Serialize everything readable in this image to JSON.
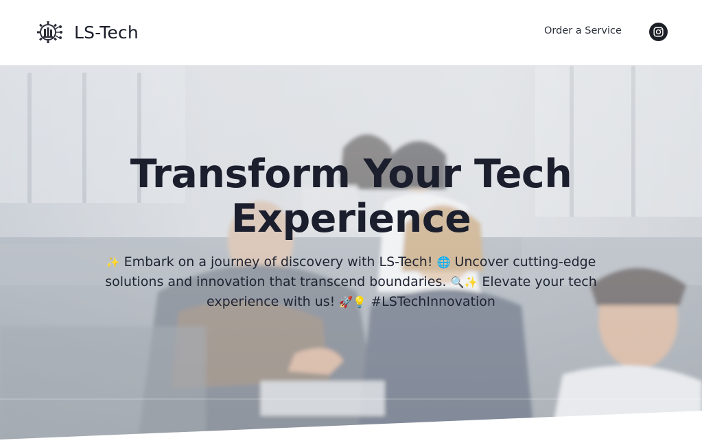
{
  "header": {
    "brand_name": "LS-Tech",
    "logo_icon": "gear-circuit-logo-icon",
    "nav_order_label": "Order a Service",
    "social_icon": "instagram-icon"
  },
  "hero": {
    "title_line1": "Transform Your Tech",
    "title_line2": "Experience",
    "text": {
      "line1_emoji_a": "✨",
      "line1_a": " Embark on a journey of discovery with LS-Tech! ",
      "line1_emoji_b": "🌐",
      "line1_b": " Uncover cutting-edge",
      "line2_a": "solutions and innovation that transcend boundaries. ",
      "line2_emoji": "🔍✨",
      "line2_b": " Elevate your tech",
      "line3_a": "experience with us! ",
      "line3_emoji": "🚀💡",
      "line3_b": " #LSTechInnovation"
    },
    "background_image": "office-team-meeting-photo"
  },
  "colors": {
    "title": "#1b1e2c",
    "overlay": "#f4f5f7"
  }
}
